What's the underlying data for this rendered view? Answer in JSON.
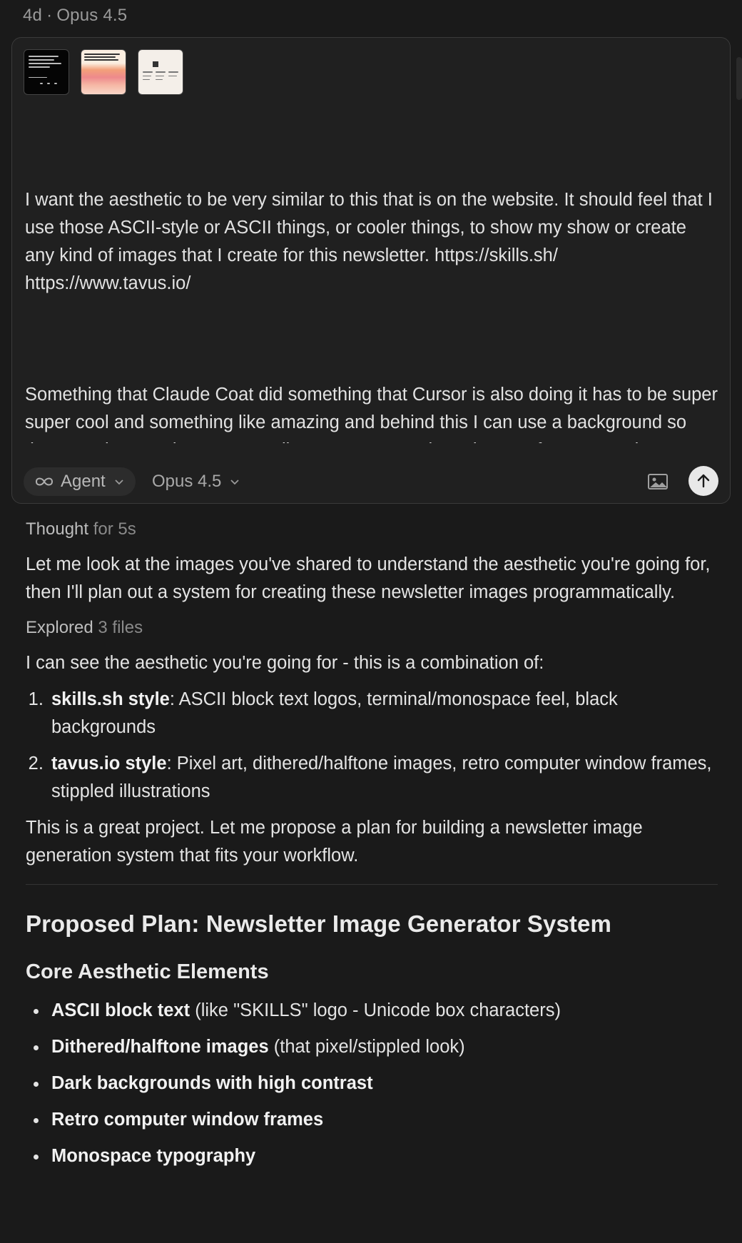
{
  "header": {
    "age": "4d",
    "separator": "·",
    "model": "Opus 4.5"
  },
  "composer": {
    "attachments": [
      {
        "name": "screenshot-skills-sh"
      },
      {
        "name": "screenshot-tavus-hero"
      },
      {
        "name": "screenshot-tavus-page"
      }
    ],
    "paragraph1": "I want the aesthetic to be very similar to this that is on the website. It should feel that I use those ASCII-style or ASCII things, or cooler things, to show my show or create any kind of images that I create for this newsletter. https://skills.sh/ https://www.tavus.io/",
    "paragraph2": "Something that Claude Coat did something that Cursor is also doing it has to be super super cool and something like amazing and behind this I can use a background so that most love my image I actually want to create those images for my newsletter so what are the ways that I can create those newsletter images? It can look really pop it should stand out and it should match it should look black and these kind of things and stuff like that instead of doing over a",
    "agent_label": "Agent",
    "model_label": "Opus 4.5"
  },
  "response": {
    "thought_label": "Thought",
    "thought_duration": "for 5s",
    "intro": "Let me look at the images you've shared to understand the aesthetic you're going for, then I'll plan out a system for creating these newsletter images programmatically.",
    "explored_label": "Explored",
    "explored_count": "3 files",
    "aesthetic_intro": "I can see the aesthetic you're going for - this is a combination of:",
    "styles": [
      {
        "name": "skills.sh style",
        "desc": ": ASCII block text logos, terminal/monospace feel, black backgrounds"
      },
      {
        "name": "tavus.io style",
        "desc": ": Pixel art, dithered/halftone images, retro computer window frames, stippled illustrations"
      }
    ],
    "project_note": "This is a great project. Let me propose a plan for building a newsletter image generation system that fits your workflow.",
    "plan_title": "Proposed Plan: Newsletter Image Generator System",
    "core_title": "Core Aesthetic Elements",
    "elements": [
      {
        "bold": "ASCII block text",
        "rest": " (like \"SKILLS\" logo - Unicode box characters)"
      },
      {
        "bold": "Dithered/halftone images",
        "rest": " (that pixel/stippled look)"
      },
      {
        "bold": "Dark backgrounds with high contrast",
        "rest": ""
      },
      {
        "bold": "Retro computer window frames",
        "rest": ""
      },
      {
        "bold": "Monospace typography",
        "rest": ""
      }
    ]
  }
}
